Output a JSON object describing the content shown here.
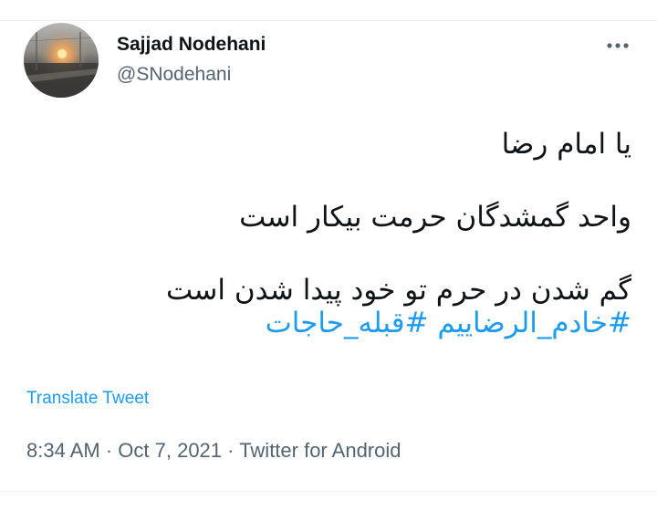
{
  "author": {
    "display_name": "Sajjad Nodehani",
    "handle": "@SNodehani"
  },
  "more_icon": "more-horizontal-icon",
  "tweet": {
    "lines": [
      "یا امام رضا",
      "واحد گمشدگان حرمت بیکار است",
      "گم شدن در حرم تو خود پیدا شدن است"
    ],
    "hashtags": [
      "#خادم_الرضاییم",
      "#قبله_حاجات"
    ]
  },
  "translate_label": "Translate Tweet",
  "meta": {
    "time": "8:34 AM",
    "separator": " · ",
    "date": "Oct 7, 2021",
    "source": "Twitter for Android"
  },
  "colors": {
    "accent": "#1d9bf0",
    "text_primary": "#0f1419",
    "text_secondary": "#536471",
    "divider": "#eff3f4"
  }
}
